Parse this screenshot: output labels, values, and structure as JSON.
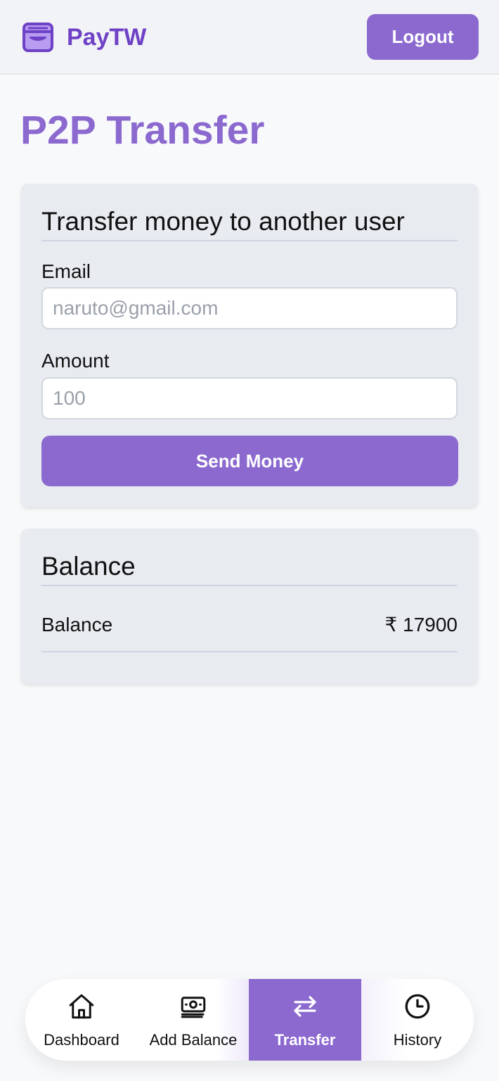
{
  "app": {
    "name": "PayTW",
    "logo_icon": "wallet-icon",
    "accent_color": "#8b69cf",
    "brand_color": "#6e41c6"
  },
  "header": {
    "logout_label": "Logout"
  },
  "page": {
    "title": "P2P Transfer"
  },
  "transfer_card": {
    "title": "Transfer money to another user",
    "email_label": "Email",
    "email_placeholder": "naruto@gmail.com",
    "amount_label": "Amount",
    "amount_placeholder": "100",
    "send_label": "Send Money"
  },
  "balance_card": {
    "title": "Balance",
    "row_label": "Balance",
    "row_value": "₹ 17900"
  },
  "bottom_nav": {
    "active": "Transfer",
    "items": [
      {
        "label": "Dashboard",
        "icon": "home-icon"
      },
      {
        "label": "Add Balance",
        "icon": "banknotes-icon"
      },
      {
        "label": "Transfer",
        "icon": "arrows-transfer-icon"
      },
      {
        "label": "History",
        "icon": "clock-icon"
      }
    ]
  }
}
